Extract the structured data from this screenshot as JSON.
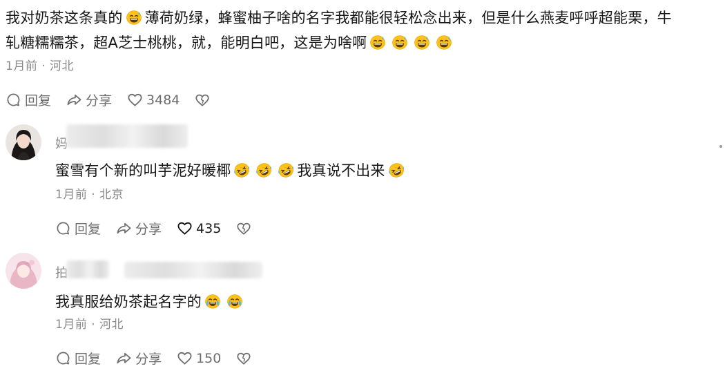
{
  "main_comment": {
    "text_line1_a": "我对奶茶这条真的",
    "text_line1_b": "薄荷奶绿，蜂蜜柚子啥的名字我都能很轻松念出来，但是什么燕麦呼呼超能栗，牛",
    "text_line2": "轧糖糯糯茶，超A芝士桃桃，就，能明白吧，这是为啥啊",
    "emoji_1": "grinning-sweat-emoji",
    "emoji_trailing": "grinning-sweat-emoji",
    "time": "1月前",
    "dot": "·",
    "location": "河北",
    "reply_label": "回复",
    "share_label": "分享",
    "like_count": "3484"
  },
  "replies": [
    {
      "username_visible": "妈",
      "username_tail": "翡翠茶汤好吃",
      "text_a": "蜜雪有个新的叫芋泥好暖椰",
      "text_b": "我真说不出来",
      "emoji": "rolling-laughing-emoji",
      "time": "1月前",
      "dot": "·",
      "location": "北京",
      "reply_label": "回复",
      "share_label": "分享",
      "like_count": "435",
      "liked": true
    },
    {
      "username_visible": "拍",
      "username_tail": "我我我",
      "text": "我真服给奶茶起名字的",
      "emoji": "crying-laughing-emoji",
      "time": "1月前",
      "dot": "·",
      "location": "河北",
      "reply_label": "回复",
      "share_label": "分享",
      "like_count": "150",
      "liked": false
    }
  ],
  "colors": {
    "text": "#161616",
    "meta": "#8a8a8a",
    "icon": "#6d6d6d",
    "emoji_face": "#fcc21b"
  }
}
